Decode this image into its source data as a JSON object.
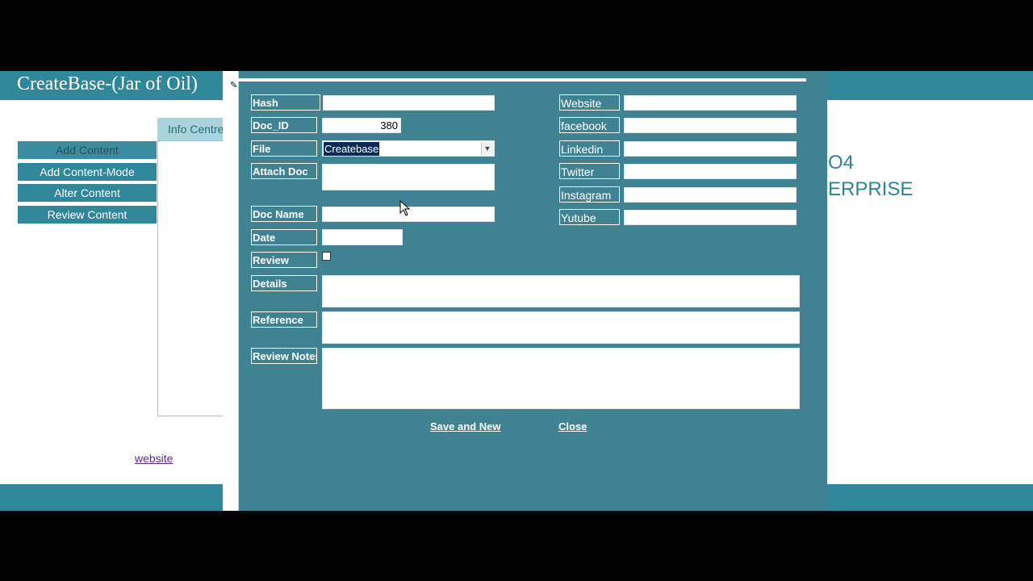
{
  "app": {
    "title": "CreateBase-(Jar of Oil)",
    "nav": [
      "Add Content",
      "Add Content-Mode",
      "Alter Content",
      "Review Content"
    ],
    "tab_label": "Info Centre",
    "link_text": "website",
    "bg_text_1": "O4",
    "bg_text_2": "ERPRISE"
  },
  "form": {
    "labels": {
      "hash": "Hash",
      "doc_id": "Doc_ID",
      "file": "File",
      "attach_doc": "Attach Doc",
      "doc_name": "Doc Name",
      "date": "Date",
      "review": "Review",
      "details": "Details",
      "reference": "Reference",
      "review_notes": "Review Notes",
      "website": "Website",
      "facebook": "facebook",
      "linkedin": "Linkedin",
      "twitter": "Twitter",
      "instagram": "Instagram",
      "yutube": "Yutube"
    },
    "values": {
      "hash": "",
      "doc_id": "380",
      "file": "Createbase",
      "attach_doc": "",
      "doc_name": "",
      "date": "",
      "review_checked": false,
      "details": "",
      "reference": "",
      "review_notes": "",
      "website": "",
      "facebook": "",
      "linkedin": "",
      "twitter": "",
      "instagram": "",
      "yutube": ""
    },
    "buttons": {
      "save_new": "Save and New",
      "close": "Close"
    }
  },
  "colors": {
    "header": "#31879a",
    "dialog": "#3f8393",
    "selection": "#0a2a5a"
  }
}
